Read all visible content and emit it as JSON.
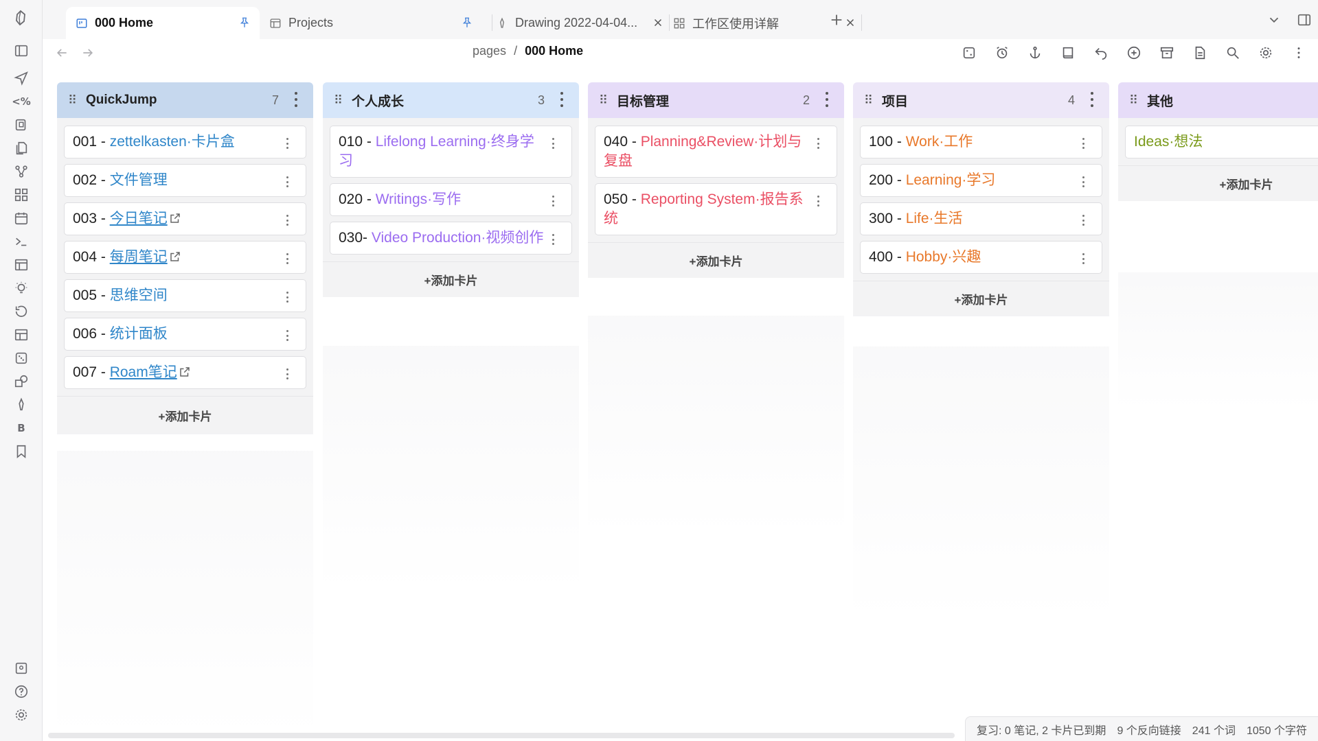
{
  "tabs": [
    {
      "label": "000 Home",
      "icon": "kanban-icon",
      "right_icon": "pin-icon"
    },
    {
      "label": "Projects",
      "icon": "table-icon",
      "right_icon": "pin-icon"
    },
    {
      "label": "Drawing 2022-04-04...",
      "icon": "pen-icon",
      "right_icon": "close-icon"
    },
    {
      "label": "工作区使用详解",
      "icon": "grid-icon",
      "right_icon": "close-icon"
    }
  ],
  "breadcrumb": {
    "parent": "pages",
    "sep": "/",
    "current": "000 Home"
  },
  "lanes": [
    {
      "title": "QuickJump",
      "count": "7",
      "header_color": "#c6d8ee",
      "cards": [
        {
          "num": "001 - ",
          "text": "zettelkasten·卡片盒",
          "color": "#2f86c9",
          "underline": false,
          "ext": false
        },
        {
          "num": "002 - ",
          "text": "文件管理",
          "color": "#2f86c9",
          "underline": false,
          "ext": false
        },
        {
          "num": "003 - ",
          "text": "今日笔记",
          "color": "#2f86c9",
          "underline": true,
          "ext": true
        },
        {
          "num": "004 - ",
          "text": "每周笔记",
          "color": "#2f86c9",
          "underline": true,
          "ext": true
        },
        {
          "num": "005 - ",
          "text": "思维空间",
          "color": "#2f86c9",
          "underline": false,
          "ext": false
        },
        {
          "num": "006 - ",
          "text": "统计面板",
          "color": "#2f86c9",
          "underline": false,
          "ext": false
        },
        {
          "num": "007 - ",
          "text": "Roam笔记",
          "color": "#2f86c9",
          "underline": true,
          "ext": true
        }
      ]
    },
    {
      "title": "个人成长",
      "count": "3",
      "header_color": "#d6e6fa",
      "cards": [
        {
          "num": "010 - ",
          "text": "Lifelong Learning·终身学习",
          "color": "#9b6cf0",
          "underline": false,
          "ext": false
        },
        {
          "num": "020 - ",
          "text": "Writings·写作",
          "color": "#9b6cf0",
          "underline": false,
          "ext": false
        },
        {
          "num": "030- ",
          "text": "Video Production·视频创作",
          "color": "#9b6cf0",
          "underline": false,
          "ext": false
        }
      ]
    },
    {
      "title": "目标管理",
      "count": "2",
      "header_color": "#e6dcf8",
      "cards": [
        {
          "num": "040 - ",
          "text": "Planning&Review·计划与复盘",
          "color": "#ea4f64",
          "underline": false,
          "ext": false
        },
        {
          "num": "050 - ",
          "text": "Reporting System·报告系统",
          "color": "#ea4f64",
          "underline": false,
          "ext": false
        }
      ]
    },
    {
      "title": "项目",
      "count": "4",
      "header_color": "#ede7f8",
      "cards": [
        {
          "num": "100 - ",
          "text": "Work·工作",
          "color": "#e8782a",
          "underline": false,
          "ext": false
        },
        {
          "num": "200 - ",
          "text": "Learning·学习",
          "color": "#e8782a",
          "underline": false,
          "ext": false
        },
        {
          "num": "300 - ",
          "text": "Life·生活",
          "color": "#e8782a",
          "underline": false,
          "ext": false
        },
        {
          "num": "400 - ",
          "text": "Hobby·兴趣",
          "color": "#e8782a",
          "underline": false,
          "ext": false
        }
      ]
    },
    {
      "title": "其他",
      "count": "",
      "header_color": "#e6dcf8",
      "cards": [
        {
          "num": "",
          "text": "Ideas·想法",
          "color": "#7a9a1a",
          "underline": false,
          "ext": false
        }
      ]
    }
  ],
  "add_card_label": "+添加卡片",
  "status": {
    "review": "复习: 0 笔记, 2 卡片已到期",
    "backlinks": "9 个反向链接",
    "words": "241 个词",
    "chars": "1050 个字符"
  }
}
